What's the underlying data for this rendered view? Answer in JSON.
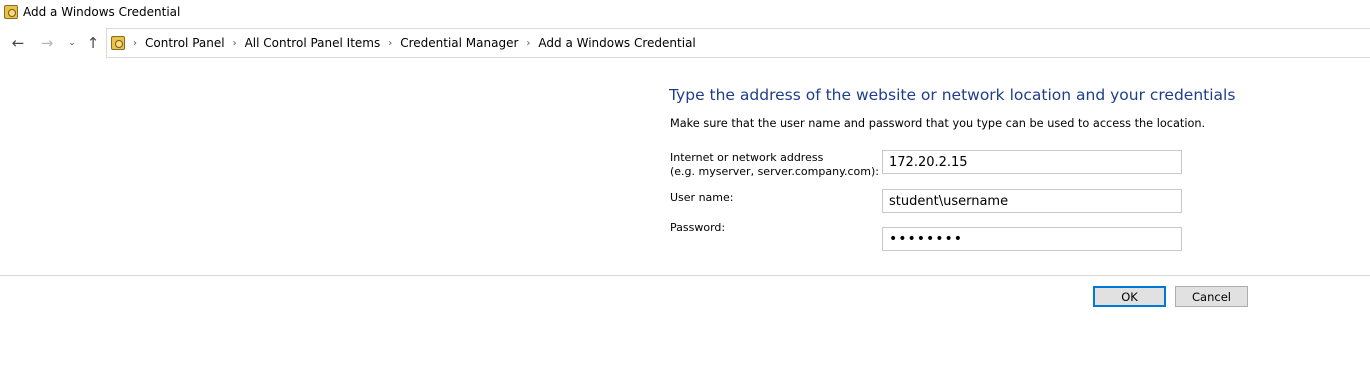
{
  "window": {
    "title": "Add a Windows Credential"
  },
  "navigation": {
    "back_icon": "arrow-left",
    "forward_icon": "arrow-right",
    "recent_icon": "chevron-down",
    "up_icon": "arrow-up",
    "breadcrumb": [
      "Control Panel",
      "All Control Panel Items",
      "Credential Manager",
      "Add a Windows Credential"
    ],
    "separator": "›"
  },
  "form": {
    "heading": "Type the address of the website or network location and your credentials",
    "instructions": "Make sure that the user name and password that you type can be used to access the location.",
    "address_label_line1": "Internet or network address",
    "address_label_line2": "(e.g. myserver, server.company.com):",
    "address_value": "172.20.2.15",
    "username_label": "User name:",
    "username_value": "student\\username",
    "password_label": "Password:",
    "password_value": "••••••••"
  },
  "buttons": {
    "ok": "OK",
    "cancel": "Cancel"
  },
  "colors": {
    "heading": "#1e3e8c",
    "default_button_border": "#0078d7"
  }
}
